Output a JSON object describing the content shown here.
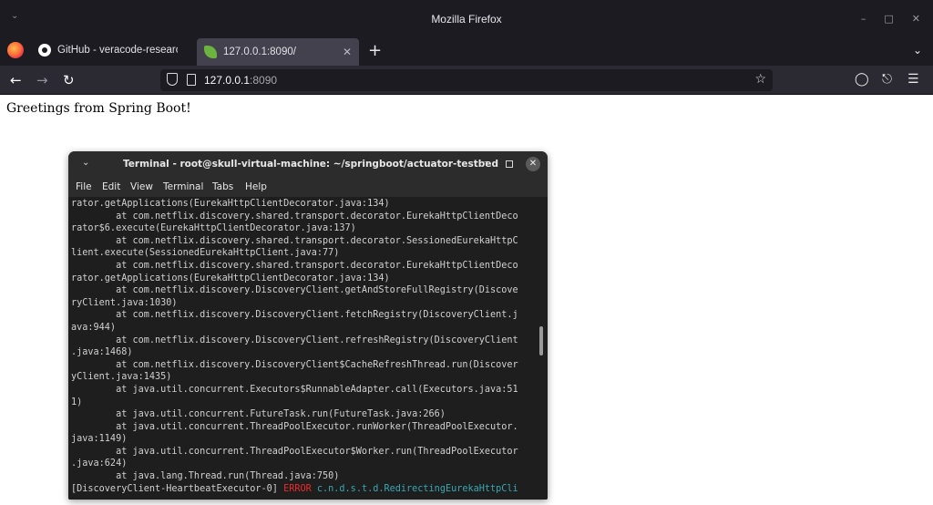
{
  "browser": {
    "window_title": "Mozilla Firefox",
    "tabs": [
      {
        "label": "GitHub - veracode-research/",
        "favicon": "github-icon",
        "active": false
      },
      {
        "label": "127.0.0.1:8090/",
        "favicon": "spring-leaf-icon",
        "active": true
      }
    ],
    "url_host": "127.0.0.1",
    "url_port": ":8090"
  },
  "page": {
    "greeting": "Greetings from Spring Boot!"
  },
  "terminal": {
    "title": "Terminal - root@skull-virtual-machine: ~/springboot/actuator-testbed",
    "menu": [
      "File",
      "Edit",
      "View",
      "Terminal",
      "Tabs",
      "Help"
    ],
    "lines": [
      "rator.getApplications(EurekaHttpClientDecorator.java:134)",
      "        at com.netflix.discovery.shared.transport.decorator.EurekaHttpClientDeco",
      "rator$6.execute(EurekaHttpClientDecorator.java:137)",
      "        at com.netflix.discovery.shared.transport.decorator.SessionedEurekaHttpC",
      "lient.execute(SessionedEurekaHttpClient.java:77)",
      "        at com.netflix.discovery.shared.transport.decorator.EurekaHttpClientDeco",
      "rator.getApplications(EurekaHttpClientDecorator.java:134)",
      "        at com.netflix.discovery.DiscoveryClient.getAndStoreFullRegistry(Discove",
      "ryClient.java:1030)",
      "        at com.netflix.discovery.DiscoveryClient.fetchRegistry(DiscoveryClient.j",
      "ava:944)",
      "        at com.netflix.discovery.DiscoveryClient.refreshRegistry(DiscoveryClient",
      ".java:1468)",
      "        at com.netflix.discovery.DiscoveryClient$CacheRefreshThread.run(Discover",
      "yClient.java:1435)",
      "        at java.util.concurrent.Executors$RunnableAdapter.call(Executors.java:51",
      "1)",
      "        at java.util.concurrent.FutureTask.run(FutureTask.java:266)",
      "        at java.util.concurrent.ThreadPoolExecutor.runWorker(ThreadPoolExecutor.",
      "java:1149)",
      "        at java.util.concurrent.ThreadPoolExecutor$Worker.run(ThreadPoolExecutor",
      ".java:624)",
      "        at java.lang.Thread.run(Thread.java:750)"
    ],
    "last_line": {
      "thread": "[DiscoveryClient-HeartbeatExecutor-0] ",
      "level": "ERROR",
      "logger": " c.n.d.s.t.d.RedirectingEurekaHttpCli"
    }
  },
  "colors": {
    "error": "#ef2929",
    "logger": "#34a9b4"
  }
}
